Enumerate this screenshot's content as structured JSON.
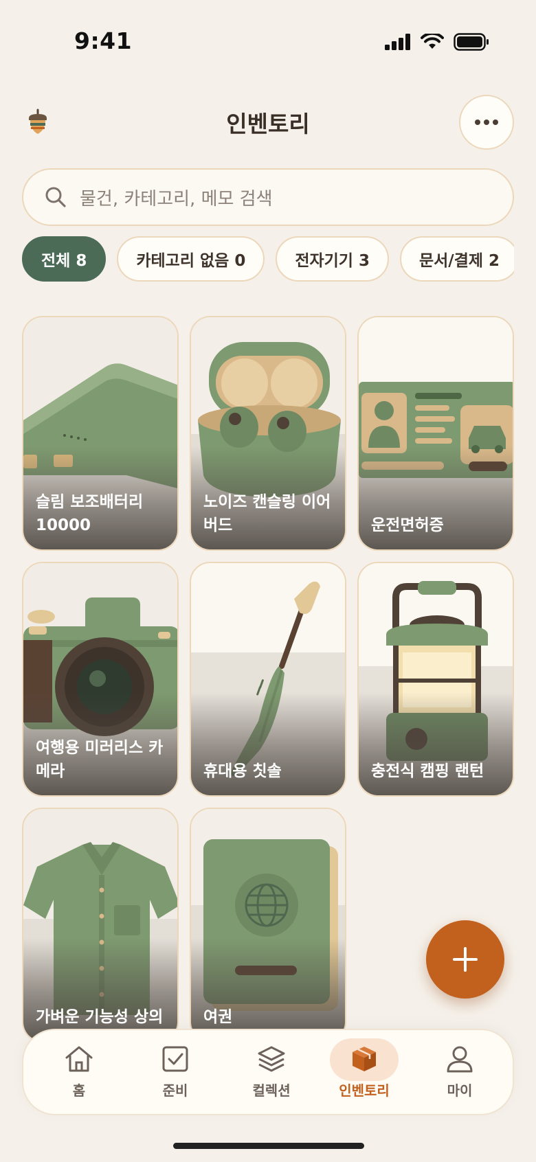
{
  "status_bar": {
    "time": "9:41"
  },
  "header": {
    "title": "인벤토리"
  },
  "search": {
    "placeholder": "물건, 카테고리, 메모 검색"
  },
  "chips": [
    {
      "label": "전체 8",
      "active": true
    },
    {
      "label": "카테고리 없음 0",
      "active": false
    },
    {
      "label": "전자기기 3",
      "active": false
    },
    {
      "label": "문서/결제 2",
      "active": false
    }
  ],
  "items": [
    {
      "label": "슬림 보조배터리 10000",
      "icon": "power-bank"
    },
    {
      "label": "노이즈 캔슬링 이어버드",
      "icon": "earbuds"
    },
    {
      "label": "운전면허증",
      "icon": "driver-license"
    },
    {
      "label": "여행용 미러리스 카메라",
      "icon": "camera"
    },
    {
      "label": "휴대용 칫솔",
      "icon": "toothbrush"
    },
    {
      "label": "충전식 캠핑 랜턴",
      "icon": "lantern"
    },
    {
      "label": "가벼운 기능성 상의",
      "icon": "shirt"
    },
    {
      "label": "여권",
      "icon": "passport"
    }
  ],
  "fab": {
    "icon": "plus-icon"
  },
  "nav": [
    {
      "label": "홈",
      "icon": "home-icon",
      "active": false
    },
    {
      "label": "준비",
      "icon": "checkbox-icon",
      "active": false
    },
    {
      "label": "컬렉션",
      "icon": "layers-icon",
      "active": false
    },
    {
      "label": "인벤토리",
      "icon": "box-icon",
      "active": true
    },
    {
      "label": "마이",
      "icon": "user-icon",
      "active": false
    }
  ],
  "colors": {
    "background": "#f5f1ea",
    "accent_green": "#4b6b57",
    "accent_orange": "#c2601d",
    "border": "#ecd7bb"
  }
}
